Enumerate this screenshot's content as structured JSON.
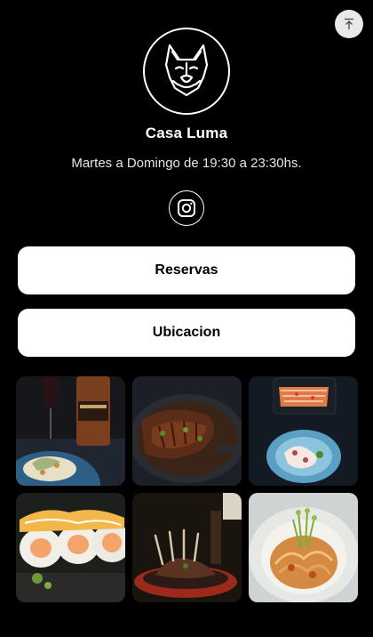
{
  "header": {
    "title": "Casa Luma",
    "hours": "Martes a Domingo de 19:30 a 23:30hs."
  },
  "icons": {
    "scroll_top": "arrow-up-to-line-icon",
    "logo": "french-bulldog-logo",
    "social": "instagram-icon"
  },
  "buttons": {
    "reservas": "Reservas",
    "ubicacion": "Ubicacion"
  },
  "gallery": [
    {
      "name": "wine-and-dish-photo"
    },
    {
      "name": "grilled-ribs-photo"
    },
    {
      "name": "sashimi-platter-photo"
    },
    {
      "name": "sushi-rolls-photo"
    },
    {
      "name": "lamb-rack-photo"
    },
    {
      "name": "noodle-bowl-photo"
    }
  ],
  "colors": {
    "background": "#000000",
    "button_bg": "#ffffff",
    "button_text": "#000000",
    "scroll_top_bg": "#e9e9e9"
  }
}
